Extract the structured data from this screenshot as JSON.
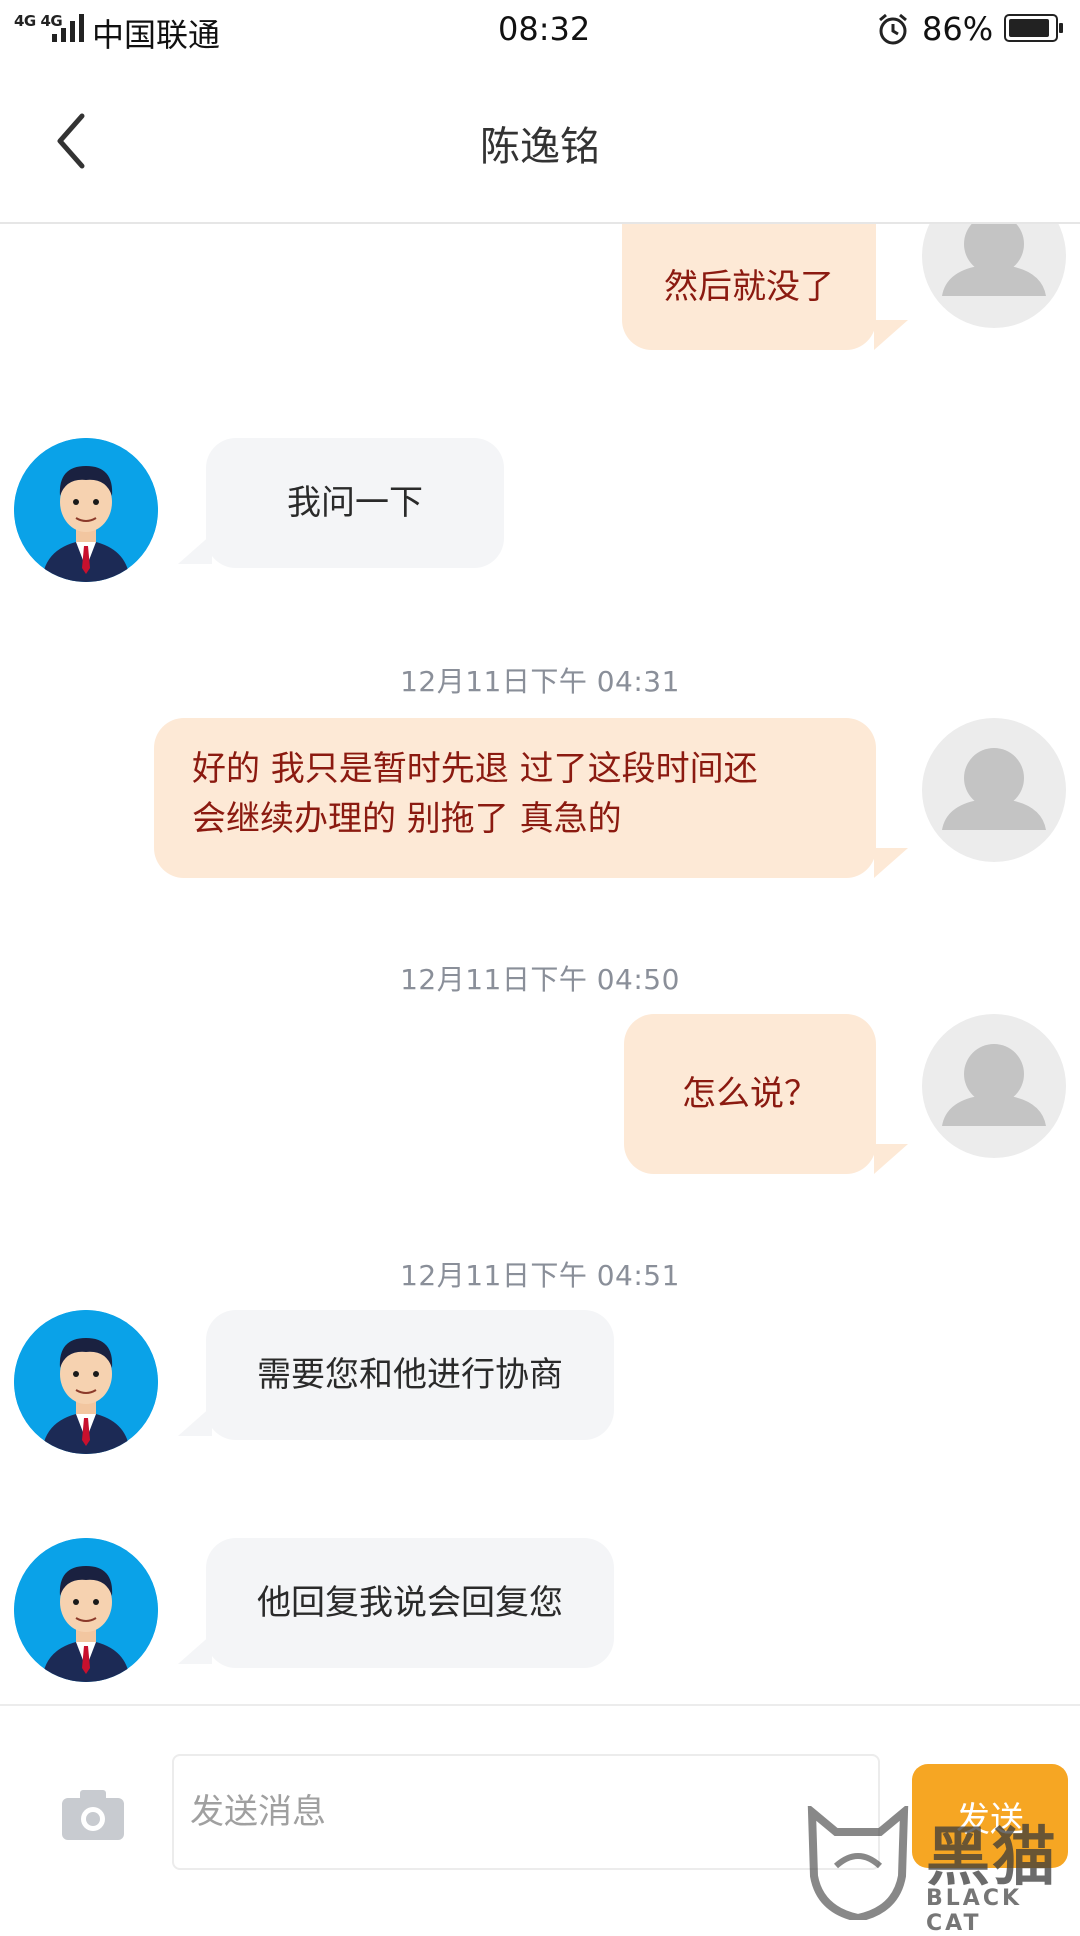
{
  "status_bar": {
    "network": "4G 4G",
    "carrier": "中国联通",
    "time": "08:32",
    "battery": "86%",
    "icons": [
      "signal-icon",
      "alarm-icon",
      "battery-icon"
    ]
  },
  "header": {
    "title": "陈逸铭",
    "back_icon": "chevron-left-icon"
  },
  "messages": {
    "m1": {
      "sender": "self",
      "text": "然后就没了"
    },
    "m2": {
      "sender": "other",
      "text": "我问一下"
    },
    "t1": "12月11日下午  04:31",
    "m3": {
      "sender": "self",
      "line1": "好的  我只是暂时先退  过了这段时间还",
      "line2": "会继续办理的  别拖了  真急的"
    },
    "t2": "12月11日下午  04:50",
    "m4": {
      "sender": "self",
      "text": "怎么说？"
    },
    "t3": "12月11日下午  04:51",
    "m5": {
      "sender": "other",
      "text": "需要您和他进行协商"
    },
    "m6": {
      "sender": "other",
      "text": "他回复我说会回复您"
    }
  },
  "input_bar": {
    "camera_icon": "camera-icon",
    "placeholder": "发送消息",
    "send_label": "发送"
  },
  "watermark": {
    "title": "黑猫",
    "subtitle": "BLACK CAT"
  },
  "colors": {
    "self_bubble": "#fde9d6",
    "self_text": "#8b1a10",
    "other_bubble": "#f4f5f7",
    "send_button": "#f6a623",
    "agent_avatar_bg": "#0aa2e8"
  }
}
